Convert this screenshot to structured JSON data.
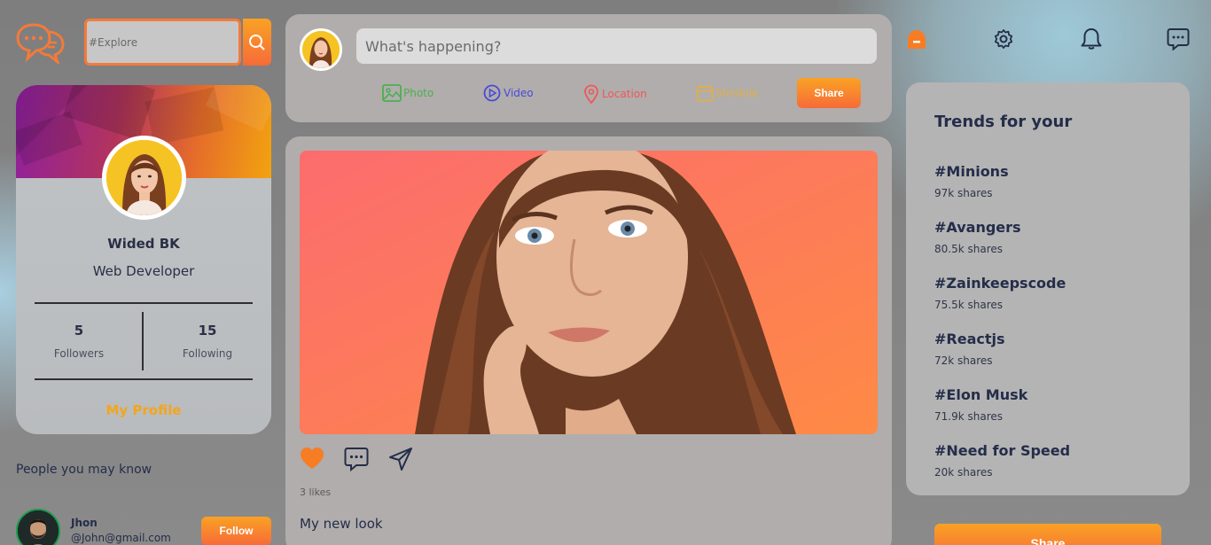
{
  "search": {
    "placeholder": "#Explore"
  },
  "profile": {
    "name": "Wided BK",
    "role": "Web Developer",
    "followers_count": "5",
    "followers_label": "Followers",
    "following_count": "15",
    "following_label": "Following",
    "link_label": "My Profile"
  },
  "people": {
    "title": "People you may know",
    "items": [
      {
        "name": "Jhon",
        "email": "@John@gmail.com",
        "button": "Follow"
      }
    ]
  },
  "composer": {
    "placeholder": "What's happening?",
    "options": [
      {
        "label": "Photo",
        "color": "#4caf50"
      },
      {
        "label": "Video",
        "color": "#4a4ad6"
      },
      {
        "label": "Location",
        "color": "#ef5757"
      },
      {
        "label": "Shedule",
        "color": "#e1ae4a"
      }
    ],
    "share_label": "Share"
  },
  "post": {
    "likes": "3 likes",
    "caption": "My new look"
  },
  "trends": {
    "title": "Trends for your",
    "items": [
      {
        "tag": "#Minions",
        "shares": "97k shares"
      },
      {
        "tag": "#Avangers",
        "shares": "80.5k shares"
      },
      {
        "tag": "#Zainkeepscode",
        "shares": "75.5k shares"
      },
      {
        "tag": "#Reactjs",
        "shares": "72k shares"
      },
      {
        "tag": "#Elon Musk",
        "shares": "71.9k shares"
      },
      {
        "tag": "#Need for Speed",
        "shares": "20k shares"
      }
    ],
    "share_label": "Share"
  },
  "colors": {
    "accent": "#f47a3a",
    "accent_light": "#f9a224",
    "highlight": "#f4a51b"
  },
  "icons": [
    "chat-logo-icon",
    "search-icon",
    "home-icon",
    "settings-icon",
    "notification-icon",
    "comment-icon",
    "heart-icon",
    "share-icon"
  ]
}
